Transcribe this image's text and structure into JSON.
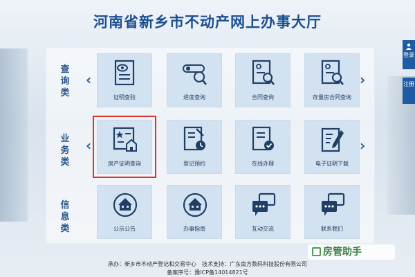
{
  "header": {
    "title": "河南省新乡市不动产网上办事大厅"
  },
  "categories": [
    {
      "label": "查询类"
    },
    {
      "label": "业务类"
    },
    {
      "label": "信息类"
    }
  ],
  "rows": [
    {
      "tiles": [
        {
          "label": "证明查验",
          "icon": "document-eye-icon"
        },
        {
          "label": "进度查询",
          "icon": "toggle-search-icon"
        },
        {
          "label": "合同查询",
          "icon": "document-search-icon"
        },
        {
          "label": "存量房合同查询",
          "icon": "document-search-icon"
        }
      ]
    },
    {
      "tiles": [
        {
          "label": "房产证明查询",
          "icon": "certificate-house-icon",
          "selected": true
        },
        {
          "label": "登记预约",
          "icon": "document-clock-icon"
        },
        {
          "label": "在线办理",
          "icon": "document-check-icon"
        },
        {
          "label": "电子证明下载",
          "icon": "document-pen-icon"
        }
      ]
    },
    {
      "tiles": [
        {
          "label": "公示公告",
          "icon": "house-sign-icon"
        },
        {
          "label": "办事指南",
          "icon": "house-sign-icon"
        },
        {
          "label": "互动交流",
          "icon": "chat-bubbles-icon"
        },
        {
          "label": "联系我们",
          "icon": "chat-bubbles-icon"
        }
      ]
    }
  ],
  "sidebar": {
    "login": "登录",
    "register": "注册"
  },
  "footer": {
    "line1": "承办：新乡市不动产登记和交易中心　技术支持：广东南方数码科技股份有限公司",
    "line2": "备案序号：豫ICP备14014821号"
  },
  "watermark": {
    "text": "房管助手"
  },
  "colors": {
    "title": "#1b4f8f",
    "tile": "#d3e2f1",
    "accent": "#1d5ba2",
    "highlight": "#e0332b"
  }
}
